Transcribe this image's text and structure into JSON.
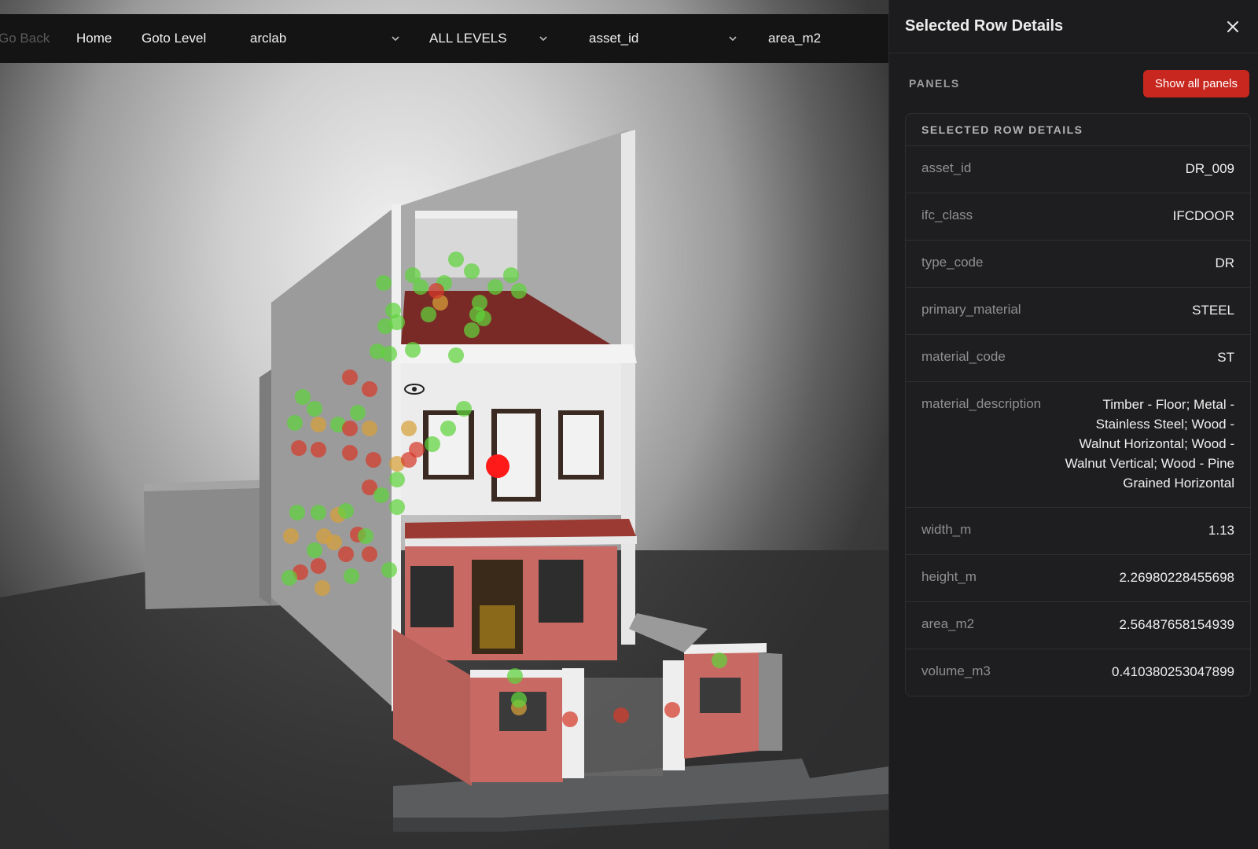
{
  "toolbar": {
    "go_back": "Go Back",
    "home": "Home",
    "goto_level": "Goto Level",
    "project_select": "arclab",
    "level_select": "ALL LEVELS",
    "field_select": "asset_id",
    "metric_select": "area_m2"
  },
  "panel": {
    "title": "Selected Row Details",
    "panels_label": "PANELS",
    "show_all_label": "Show all panels",
    "card_title": "SELECTED ROW DETAILS",
    "rows": [
      {
        "key": "asset_id",
        "value": "DR_009"
      },
      {
        "key": "ifc_class",
        "value": "IFCDOOR"
      },
      {
        "key": "type_code",
        "value": "DR"
      },
      {
        "key": "primary_material",
        "value": "STEEL"
      },
      {
        "key": "material_code",
        "value": "ST"
      },
      {
        "key": "material_description",
        "value": "Timber - Floor; Metal - Stainless Steel; Wood - Walnut Horizontal; Wood - Walnut Vertical; Wood - Pine Grained Horizontal"
      },
      {
        "key": "width_m",
        "value": "1.13"
      },
      {
        "key": "height_m",
        "value": "2.26980228455698"
      },
      {
        "key": "area_m2",
        "value": "2.56487658154939"
      },
      {
        "key": "volume_m3",
        "value": "0.410380253047899"
      }
    ]
  },
  "colors": {
    "accent": "#c8271f",
    "marker_green": "#5fd33c",
    "marker_red": "#d63a2a",
    "selected_marker": "#ff1a1a",
    "wall_red": "#c86a63",
    "roof": "#7a2a26"
  },
  "icons": {
    "close": "close-icon",
    "dropdown": "chevron-down-icon"
  }
}
